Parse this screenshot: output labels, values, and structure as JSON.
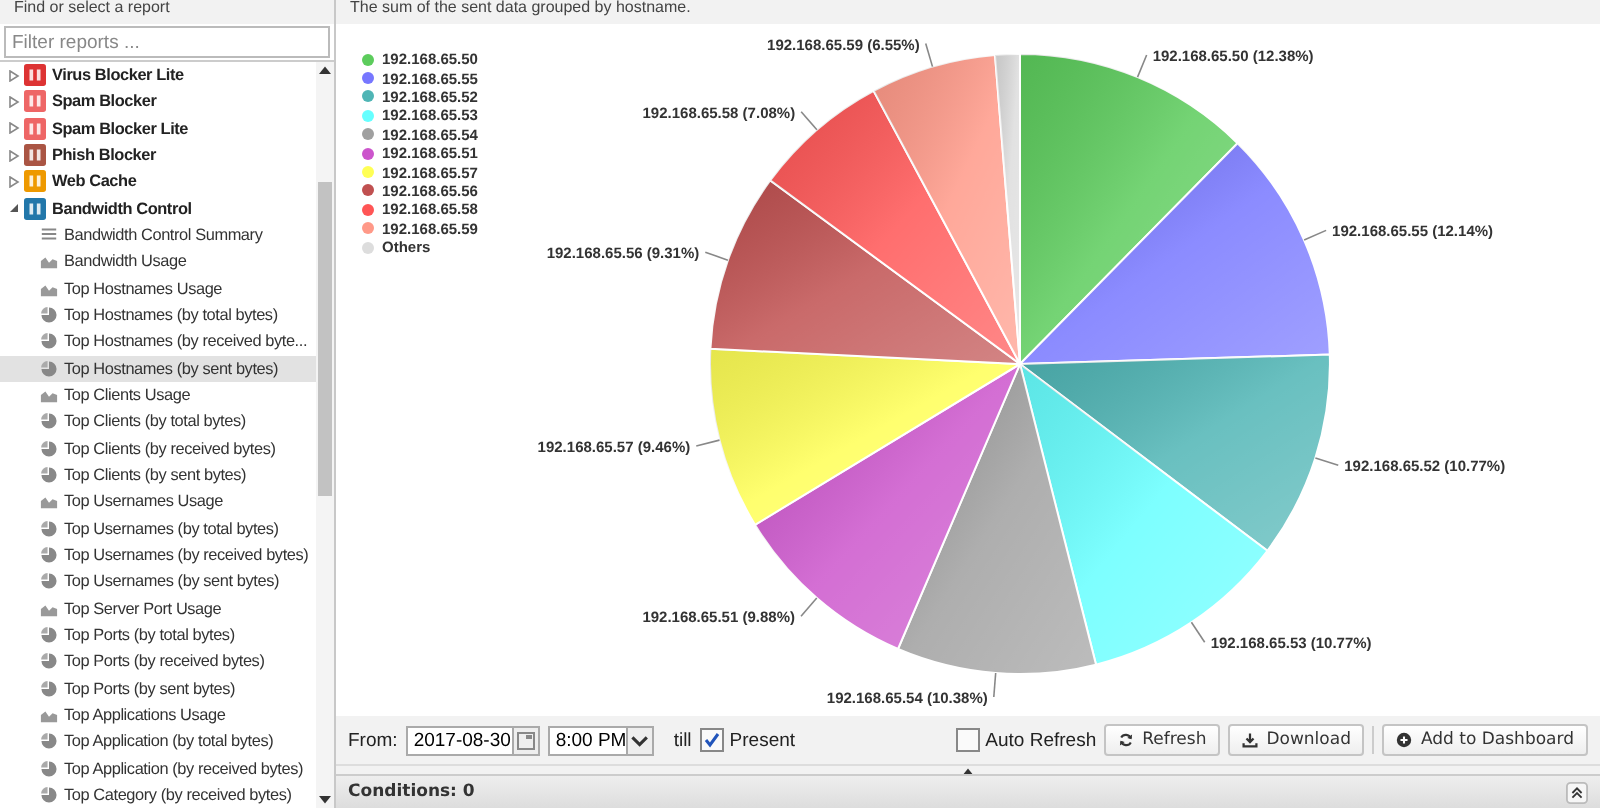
{
  "sidebar": {
    "header": "Find or select a report",
    "filter": {
      "placeholder": "Filter reports ..."
    },
    "items": [
      {
        "label": "Virus Blocker Lite",
        "expanded": false,
        "selected": false
      },
      {
        "label": "Spam Blocker",
        "expanded": false,
        "selected": false
      },
      {
        "label": "Spam Blocker Lite",
        "expanded": false,
        "selected": false
      },
      {
        "label": "Phish Blocker",
        "expanded": false,
        "selected": false
      },
      {
        "label": "Web Cache",
        "expanded": false,
        "selected": false
      },
      {
        "label": "Bandwidth Control",
        "expanded": true,
        "selected": false,
        "children": [
          {
            "label": "Bandwidth Control Summary",
            "kind": "text",
            "selected": false
          },
          {
            "label": "Bandwidth Usage",
            "kind": "area",
            "selected": false
          },
          {
            "label": "Top Hostnames Usage",
            "kind": "area",
            "selected": false
          },
          {
            "label": "Top Hostnames (by total bytes)",
            "kind": "pie",
            "selected": false
          },
          {
            "label": "Top Hostnames (by received byte...",
            "kind": "pie",
            "selected": false
          },
          {
            "label": "Top Hostnames (by sent bytes)",
            "kind": "pie",
            "selected": true
          },
          {
            "label": "Top Clients Usage",
            "kind": "area",
            "selected": false
          },
          {
            "label": "Top Clients (by total bytes)",
            "kind": "pie",
            "selected": false
          },
          {
            "label": "Top Clients (by received bytes)",
            "kind": "pie",
            "selected": false
          },
          {
            "label": "Top Clients (by sent bytes)",
            "kind": "pie",
            "selected": false
          },
          {
            "label": "Top Usernames Usage",
            "kind": "area",
            "selected": false
          },
          {
            "label": "Top Usernames (by total bytes)",
            "kind": "pie",
            "selected": false
          },
          {
            "label": "Top Usernames (by received bytes)",
            "kind": "pie",
            "selected": false
          },
          {
            "label": "Top Usernames (by sent bytes)",
            "kind": "pie",
            "selected": false
          },
          {
            "label": "Top Server Port Usage",
            "kind": "area",
            "selected": false
          },
          {
            "label": "Top Ports (by total bytes)",
            "kind": "pie",
            "selected": false
          },
          {
            "label": "Top Ports (by received bytes)",
            "kind": "pie",
            "selected": false
          },
          {
            "label": "Top Ports (by sent bytes)",
            "kind": "pie",
            "selected": false
          },
          {
            "label": "Top Applications Usage",
            "kind": "area",
            "selected": false
          },
          {
            "label": "Top Application (by total bytes)",
            "kind": "pie",
            "selected": false
          },
          {
            "label": "Top Application (by received bytes)",
            "kind": "pie",
            "selected": false
          },
          {
            "label": "Top Category (by received bytes)",
            "kind": "pie",
            "selected": false
          }
        ]
      }
    ]
  },
  "report": {
    "description": "The sum of the sent data grouped by hostname.",
    "chart_data": {
      "type": "pie",
      "legend": "top-left",
      "colors": [
        "#5ccc5c",
        "#7777ff",
        "#4fb5b5",
        "#66ffff",
        "#a0a0a0",
        "#cc55cc",
        "#ffff55",
        "#c05050",
        "#ff5555",
        "#ff9988",
        "#dddddd"
      ],
      "categories": [
        "192.168.65.50",
        "192.168.65.55",
        "192.168.65.52",
        "192.168.65.53",
        "192.168.65.54",
        "192.168.65.51",
        "192.168.65.57",
        "192.168.65.56",
        "192.168.65.58",
        "192.168.65.59",
        "Others"
      ],
      "values": [
        12.38,
        12.14,
        10.77,
        10.77,
        10.38,
        9.88,
        9.46,
        9.31,
        7.08,
        6.55,
        1.28
      ],
      "value_labels": [
        "192.168.65.50 (12.38%)",
        "192.168.65.55 (12.14%)",
        "192.168.65.52 (10.77%)",
        "192.168.65.53 (10.77%)",
        "192.168.65.54 (10.38%)",
        "192.168.65.51 (9.88%)",
        "192.168.65.57 (9.46%)",
        "192.168.65.56 (9.31%)",
        "192.168.65.58 (7.08%)",
        "192.168.65.59 (6.55%)",
        null
      ]
    }
  },
  "toolbar": {
    "from_label": "From:",
    "date": "2017-08-30",
    "time": "8:00 PM",
    "till_label": "till",
    "present": {
      "label": "Present",
      "checked": true
    },
    "auto_refresh": {
      "label": "Auto Refresh",
      "checked": false
    },
    "buttons": [
      {
        "label": "Refresh",
        "kind": "refresh"
      },
      {
        "label": "Download",
        "kind": "download"
      },
      {
        "label": "Add to Dashboard",
        "kind": "add"
      }
    ]
  },
  "conditions": {
    "label": "Conditions: 0"
  }
}
